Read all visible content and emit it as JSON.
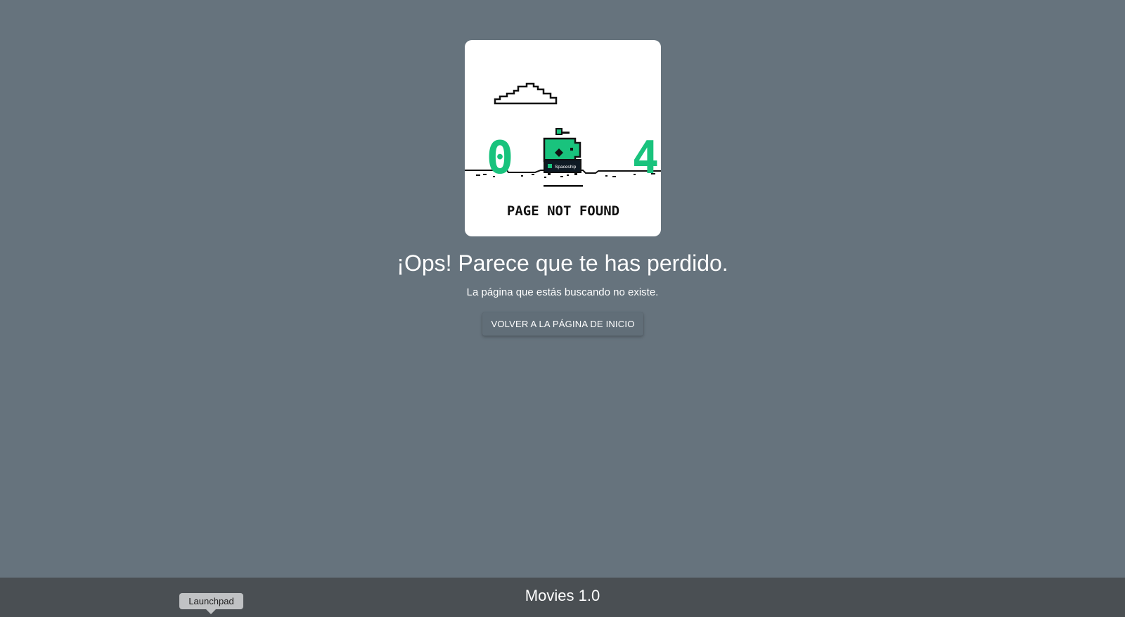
{
  "error_illustration": {
    "digit_left": "0",
    "digit_right": "4",
    "spaceship_label": "Spaceship",
    "caption": "PAGE NOT FOUND",
    "accent_color": "#19c37d"
  },
  "main": {
    "headline": "¡Ops! Parece que te has perdido.",
    "subtitle": "La página que estás buscando no existe.",
    "home_button_label": "VOLVER A LA PÁGINA DE INICIO"
  },
  "footer": {
    "title": "Movies 1.0",
    "tooltip": "Launchpad"
  },
  "colors": {
    "background": "#66737d",
    "footer": "#4a4f53"
  }
}
